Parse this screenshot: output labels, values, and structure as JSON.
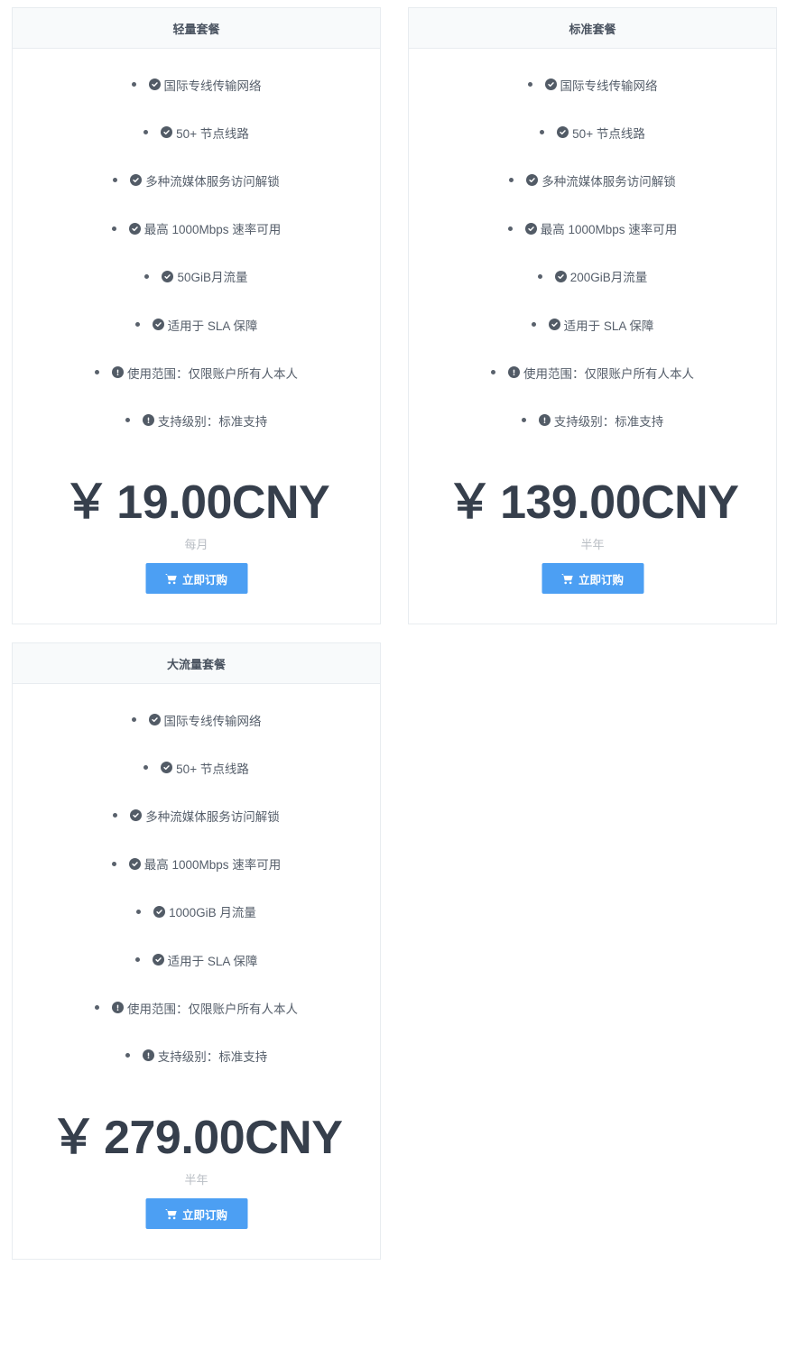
{
  "plans": [
    {
      "name": "轻量套餐",
      "features": [
        {
          "icon": "check-circle-icon",
          "text": "国际专线传输网络"
        },
        {
          "icon": "check-circle-icon",
          "text": "50+ 节点线路"
        },
        {
          "icon": "check-circle-icon",
          "text": "多种流媒体服务访问解锁"
        },
        {
          "icon": "check-circle-icon",
          "text": "最高 1000Mbps 速率可用"
        },
        {
          "icon": "check-circle-icon",
          "text": "50GiB月流量"
        },
        {
          "icon": "check-circle-icon",
          "text": "适用于 SLA 保障"
        },
        {
          "icon": "exclamation-circle-icon",
          "text": "使用范围：仅限账户所有人本人"
        },
        {
          "icon": "exclamation-circle-icon",
          "text": "支持级别：标准支持"
        }
      ],
      "currency_symbol": "￥",
      "price": "19.00CNY",
      "period": "每月",
      "button_label": "立即订购"
    },
    {
      "name": "标准套餐",
      "features": [
        {
          "icon": "check-circle-icon",
          "text": "国际专线传输网络"
        },
        {
          "icon": "check-circle-icon",
          "text": "50+ 节点线路"
        },
        {
          "icon": "check-circle-icon",
          "text": "多种流媒体服务访问解锁"
        },
        {
          "icon": "check-circle-icon",
          "text": "最高 1000Mbps 速率可用"
        },
        {
          "icon": "check-circle-icon",
          "text": "200GiB月流量"
        },
        {
          "icon": "check-circle-icon",
          "text": "适用于 SLA 保障"
        },
        {
          "icon": "exclamation-circle-icon",
          "text": "使用范围：仅限账户所有人本人"
        },
        {
          "icon": "exclamation-circle-icon",
          "text": "支持级别：标准支持"
        }
      ],
      "currency_symbol": "￥",
      "price": "139.00CNY",
      "period": "半年",
      "button_label": "立即订购"
    },
    {
      "name": "大流量套餐",
      "features": [
        {
          "icon": "check-circle-icon",
          "text": "国际专线传输网络"
        },
        {
          "icon": "check-circle-icon",
          "text": "50+ 节点线路"
        },
        {
          "icon": "check-circle-icon",
          "text": "多种流媒体服务访问解锁"
        },
        {
          "icon": "check-circle-icon",
          "text": "最高 1000Mbps 速率可用"
        },
        {
          "icon": "check-circle-icon",
          "text": "1000GiB 月流量"
        },
        {
          "icon": "check-circle-icon",
          "text": "适用于 SLA 保障"
        },
        {
          "icon": "exclamation-circle-icon",
          "text": "使用范围：仅限账户所有人本人"
        },
        {
          "icon": "exclamation-circle-icon",
          "text": "支持级别：标准支持"
        }
      ],
      "currency_symbol": "￥",
      "price": "279.00CNY",
      "period": "半年",
      "button_label": "立即订购"
    }
  ],
  "colors": {
    "accent": "#4c9ff3",
    "price_text": "#363f4c",
    "icon": "#525b66",
    "period_text": "#b9bec4",
    "header_bg": "#f8fafb",
    "border": "#e8ecf0"
  },
  "button_icon": "shopping-cart-icon"
}
